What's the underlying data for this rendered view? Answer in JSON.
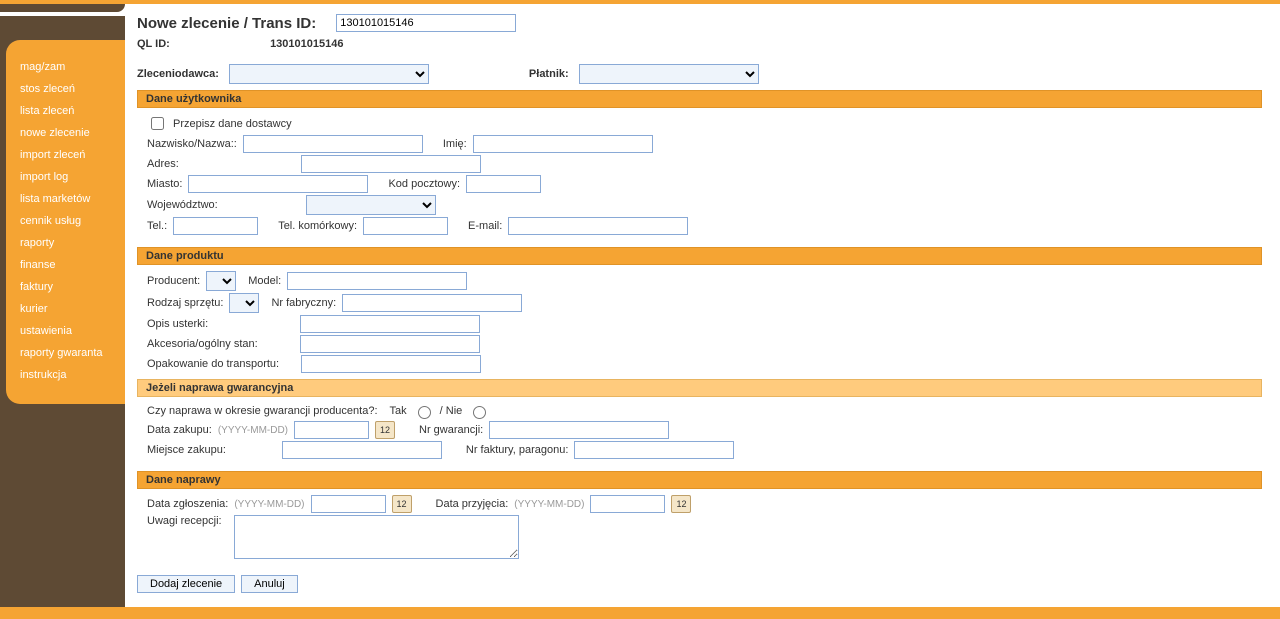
{
  "sidebar": {
    "items": [
      "mag/zam",
      "stos zleceń",
      "lista zleceń",
      "nowe zlecenie",
      "import zleceń",
      "import log",
      "lista marketów",
      "cennik usług",
      "raporty",
      "finanse",
      "faktury",
      "kurier",
      "ustawienia",
      "raporty gwaranta",
      "instrukcja"
    ]
  },
  "page": {
    "title": "Nowe zlecenie / Trans ID:",
    "trans_id_value": "130101015146",
    "qlid_label": "QL ID:",
    "qlid_value": "130101015146"
  },
  "party": {
    "zleceniodawca_label": "Zleceniodawca:",
    "platnik_label": "Płatnik:"
  },
  "user_section": {
    "header": "Dane użytkownika",
    "copy_supplier": "Przepisz dane dostawcy",
    "surname_label": "Nazwisko/Nazwa::",
    "name_label": "Imię:",
    "address_label": "Adres:",
    "city_label": "Miasto:",
    "zip_label": "Kod pocztowy:",
    "voiv_label": "Województwo:",
    "tel_label": "Tel.:",
    "mobile_label": "Tel. komórkowy:",
    "email_label": "E-mail:"
  },
  "product_section": {
    "header": "Dane produktu",
    "producer_label": "Producent:",
    "model_label": "Model:",
    "hw_type_label": "Rodzaj sprzętu:",
    "serial_label": "Nr fabryczny:",
    "fault_label": "Opis usterki:",
    "accessories_label": "Akcesoria/ogólny stan:",
    "packaging_label": "Opakowanie do transportu:"
  },
  "warranty_section": {
    "header": "Jeżeli naprawa gwarancyjna",
    "question": "Czy naprawa w okresie gwarancji producenta?:",
    "yes": "Tak",
    "sep": "/ Nie",
    "purchase_date_label": "Data zakupu:",
    "date_hint": "(YYYY-MM-DD)",
    "warranty_no_label": "Nr gwarancji:",
    "purchase_place_label": "Miejsce zakupu:",
    "invoice_no_label": "Nr faktury, paragonu:"
  },
  "repair_section": {
    "header": "Dane naprawy",
    "report_date_label": "Data zgłoszenia:",
    "accept_date_label": "Data przyjęcia:",
    "date_hint": "(YYYY-MM-DD)",
    "reception_notes_label": "Uwagi recepcji:"
  },
  "buttons": {
    "submit": "Dodaj zlecenie",
    "cancel": "Anuluj"
  },
  "icons": {
    "calendar_glyph": "12"
  }
}
